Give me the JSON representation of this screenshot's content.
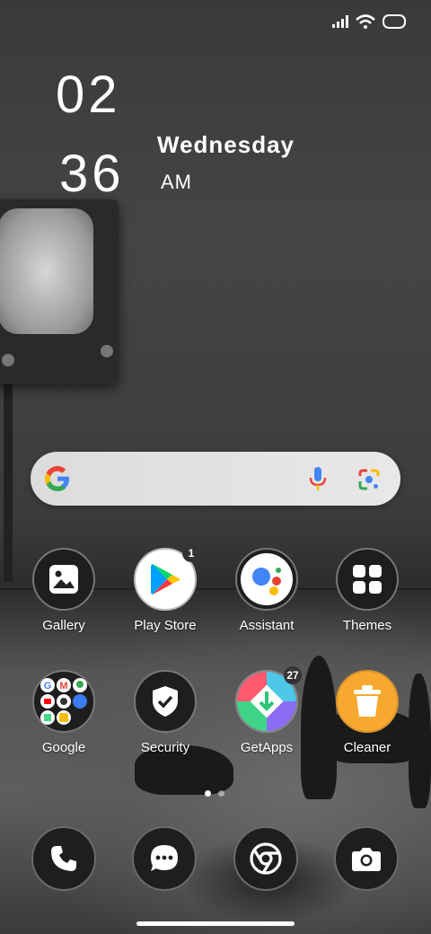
{
  "status_bar": {
    "signal_icon": "signal-icon",
    "wifi_icon": "wifi-icon",
    "battery_icon": "battery-icon"
  },
  "clock": {
    "hour": "02",
    "minute": "36",
    "day": "Wednesday",
    "ampm": "AM"
  },
  "search": {
    "logo": "G",
    "mic_icon": "mic-icon",
    "lens_icon": "lens-icon"
  },
  "apps_row1": [
    {
      "label": "Gallery",
      "icon": "gallery-icon"
    },
    {
      "label": "Play Store",
      "icon": "play-store-icon",
      "badge": "1"
    },
    {
      "label": "Assistant",
      "icon": "assistant-icon"
    },
    {
      "label": "Themes",
      "icon": "themes-icon"
    }
  ],
  "apps_row2": [
    {
      "label": "Google",
      "icon": "google-folder-icon"
    },
    {
      "label": "Security",
      "icon": "security-icon"
    },
    {
      "label": "GetApps",
      "icon": "getapps-icon",
      "badge": "27"
    },
    {
      "label": "Cleaner",
      "icon": "cleaner-icon"
    }
  ],
  "dock": [
    {
      "icon": "phone-icon"
    },
    {
      "icon": "messages-icon"
    },
    {
      "icon": "chrome-icon"
    },
    {
      "icon": "camera-icon"
    }
  ],
  "pager": {
    "pages": 2,
    "current": 1
  },
  "colors": {
    "cleaner": "#f7a92f",
    "playstore_bg": "#ffffff",
    "assistant_bg": "#ffffff",
    "badge": "#333333"
  }
}
